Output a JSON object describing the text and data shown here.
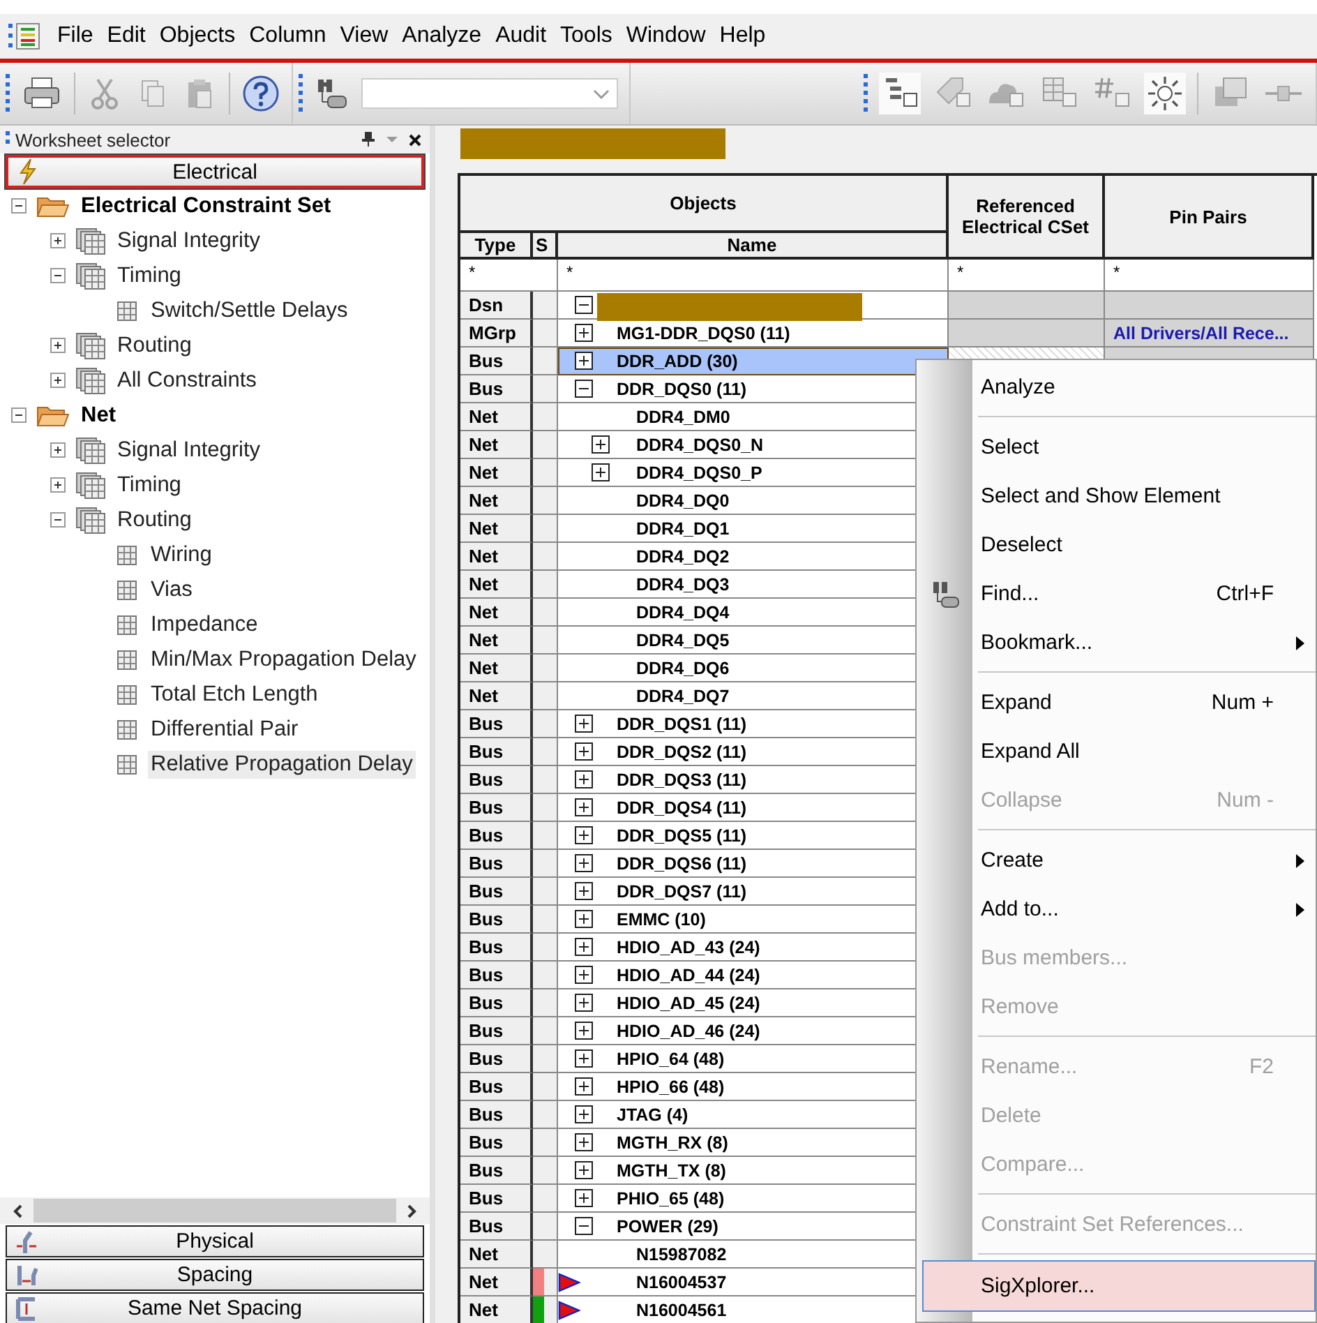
{
  "menu_bar": [
    "File",
    "Edit",
    "Objects",
    "Column",
    "View",
    "Analyze",
    "Audit",
    "Tools",
    "Window",
    "Help"
  ],
  "worksheet_selector": {
    "title": "Worksheet selector",
    "tabs": [
      {
        "label": "Electrical",
        "selected": true,
        "kind": "electrical"
      }
    ],
    "tree": [
      {
        "label": "Electrical Constraint Set",
        "kind": "folder",
        "expanded": true,
        "selected": false,
        "children": [
          {
            "label": "Signal Integrity",
            "kind": "stack",
            "expanded": false,
            "selected": false
          },
          {
            "label": "Timing",
            "kind": "stack",
            "expanded": true,
            "selected": false,
            "children": [
              {
                "label": "Switch/Settle Delays",
                "kind": "sheet",
                "selected": false
              }
            ]
          },
          {
            "label": "Routing",
            "kind": "stack",
            "expanded": false,
            "selected": false
          },
          {
            "label": "All Constraints",
            "kind": "stack",
            "expanded": false,
            "selected": false
          }
        ]
      },
      {
        "label": "Net",
        "kind": "folder",
        "expanded": true,
        "selected": false,
        "children": [
          {
            "label": "Signal Integrity",
            "kind": "stack",
            "expanded": false,
            "selected": false
          },
          {
            "label": "Timing",
            "kind": "stack",
            "expanded": false,
            "selected": false
          },
          {
            "label": "Routing",
            "kind": "stack",
            "expanded": true,
            "selected": false,
            "children": [
              {
                "label": "Wiring",
                "kind": "sheet",
                "selected": false
              },
              {
                "label": "Vias",
                "kind": "sheet",
                "selected": false
              },
              {
                "label": "Impedance",
                "kind": "sheet",
                "selected": false
              },
              {
                "label": "Min/Max Propagation Delay",
                "kind": "sheet",
                "selected": false
              },
              {
                "label": "Total Etch Length",
                "kind": "sheet",
                "selected": false
              },
              {
                "label": "Differential Pair",
                "kind": "sheet",
                "selected": false
              },
              {
                "label": "Relative Propagation Delay",
                "kind": "sheet",
                "selected": true
              }
            ]
          }
        ]
      }
    ],
    "bottom_tabs": [
      {
        "label": "Physical",
        "selected": false,
        "kind": "physical"
      },
      {
        "label": "Spacing",
        "selected": false,
        "kind": "spacing"
      },
      {
        "label": "Same Net Spacing",
        "selected": false,
        "kind": "same-net"
      }
    ]
  },
  "table": {
    "group_header": "Objects",
    "columns": [
      "Type",
      "S",
      "Name",
      "Referenced Electrical CSet",
      "Pin Pairs"
    ],
    "filters": [
      "*",
      "*",
      "*",
      "*"
    ],
    "rows": [
      {
        "type": "Dsn",
        "expanded": true,
        "selected": false,
        "children": [
          {
            "type": "MGrp",
            "name": "MG1-DDR_DQS0 (11)",
            "expanded": false,
            "selected": false,
            "pin_pairs": "All Drivers/All Rece..."
          },
          {
            "type": "Bus",
            "name": "DDR_ADD (30)",
            "expanded": false,
            "selected": true
          },
          {
            "type": "Bus",
            "name": "DDR_DQS0 (11)",
            "expanded": true,
            "selected": false,
            "children": [
              {
                "type": "Net",
                "name": "DDR4_DM0",
                "selected": false
              },
              {
                "type": "Net",
                "name": "DDR4_DQS0_N",
                "expanded": false,
                "selected": false
              },
              {
                "type": "Net",
                "name": "DDR4_DQS0_P",
                "expanded": false,
                "selected": false
              },
              {
                "type": "Net",
                "name": "DDR4_DQ0",
                "selected": false
              },
              {
                "type": "Net",
                "name": "DDR4_DQ1",
                "selected": false
              },
              {
                "type": "Net",
                "name": "DDR4_DQ2",
                "selected": false
              },
              {
                "type": "Net",
                "name": "DDR4_DQ3",
                "selected": false
              },
              {
                "type": "Net",
                "name": "DDR4_DQ4",
                "selected": false
              },
              {
                "type": "Net",
                "name": "DDR4_DQ5",
                "selected": false
              },
              {
                "type": "Net",
                "name": "DDR4_DQ6",
                "selected": false
              },
              {
                "type": "Net",
                "name": "DDR4_DQ7",
                "selected": false
              }
            ]
          },
          {
            "type": "Bus",
            "name": "DDR_DQS1 (11)",
            "expanded": false,
            "selected": false
          },
          {
            "type": "Bus",
            "name": "DDR_DQS2 (11)",
            "expanded": false,
            "selected": false
          },
          {
            "type": "Bus",
            "name": "DDR_DQS3 (11)",
            "expanded": false,
            "selected": false
          },
          {
            "type": "Bus",
            "name": "DDR_DQS4 (11)",
            "expanded": false,
            "selected": false
          },
          {
            "type": "Bus",
            "name": "DDR_DQS5 (11)",
            "expanded": false,
            "selected": false
          },
          {
            "type": "Bus",
            "name": "DDR_DQS6 (11)",
            "expanded": false,
            "selected": false
          },
          {
            "type": "Bus",
            "name": "DDR_DQS7 (11)",
            "expanded": false,
            "selected": false
          },
          {
            "type": "Bus",
            "name": "EMMC (10)",
            "expanded": false,
            "selected": false
          },
          {
            "type": "Bus",
            "name": "HDIO_AD_43 (24)",
            "expanded": false,
            "selected": false
          },
          {
            "type": "Bus",
            "name": "HDIO_AD_44 (24)",
            "expanded": false,
            "selected": false
          },
          {
            "type": "Bus",
            "name": "HDIO_AD_45 (24)",
            "expanded": false,
            "selected": false
          },
          {
            "type": "Bus",
            "name": "HDIO_AD_46 (24)",
            "expanded": false,
            "selected": false
          },
          {
            "type": "Bus",
            "name": "HPIO_64 (48)",
            "expanded": false,
            "selected": false
          },
          {
            "type": "Bus",
            "name": "HPIO_66 (48)",
            "expanded": false,
            "selected": false
          },
          {
            "type": "Bus",
            "name": "JTAG (4)",
            "expanded": false,
            "selected": false
          },
          {
            "type": "Bus",
            "name": "MGTH_RX (8)",
            "expanded": false,
            "selected": false
          },
          {
            "type": "Bus",
            "name": "MGTH_TX (8)",
            "expanded": false,
            "selected": false
          },
          {
            "type": "Bus",
            "name": "PHIO_65 (48)",
            "expanded": false,
            "selected": false
          },
          {
            "type": "Bus",
            "name": "POWER (29)",
            "expanded": true,
            "selected": false,
            "children": [
              {
                "type": "Net",
                "name": "N15987082",
                "selected": false
              },
              {
                "type": "Net",
                "name": "N16004537",
                "selected": false,
                "color": "#f28080",
                "flagged": true
              },
              {
                "type": "Net",
                "name": "N16004561",
                "selected": false,
                "color": "#10a010",
                "flagged": true
              }
            ]
          }
        ]
      }
    ]
  },
  "context_menu": [
    {
      "kind": "item",
      "label": "Analyze",
      "selected": false,
      "disabled": false
    },
    {
      "kind": "separator"
    },
    {
      "kind": "item",
      "label": "Select",
      "selected": false,
      "disabled": false
    },
    {
      "kind": "item",
      "label": "Select and Show Element",
      "selected": false,
      "disabled": false
    },
    {
      "kind": "item",
      "label": "Deselect",
      "selected": false,
      "disabled": false
    },
    {
      "kind": "tool",
      "label": "Find...",
      "shortcut": "Ctrl+F",
      "selected": false,
      "disabled": false
    },
    {
      "kind": "item",
      "label": "Bookmark...",
      "submenu": true,
      "selected": false,
      "disabled": false
    },
    {
      "kind": "separator"
    },
    {
      "kind": "item",
      "label": "Expand",
      "shortcut": "Num +",
      "selected": false,
      "disabled": false
    },
    {
      "kind": "item",
      "label": "Expand All",
      "selected": false,
      "disabled": false
    },
    {
      "kind": "item",
      "label": "Collapse",
      "shortcut": "Num -",
      "selected": false,
      "disabled": true
    },
    {
      "kind": "separator"
    },
    {
      "kind": "item",
      "label": "Create",
      "submenu": true,
      "selected": false,
      "disabled": false
    },
    {
      "kind": "item",
      "label": "Add to...",
      "submenu": true,
      "selected": false,
      "disabled": false
    },
    {
      "kind": "item",
      "label": "Bus members...",
      "selected": false,
      "disabled": true
    },
    {
      "kind": "item",
      "label": "Remove",
      "selected": false,
      "disabled": true
    },
    {
      "kind": "separator"
    },
    {
      "kind": "item",
      "label": "Rename...",
      "shortcut": "F2",
      "selected": false,
      "disabled": true
    },
    {
      "kind": "item",
      "label": "Delete",
      "selected": false,
      "disabled": true
    },
    {
      "kind": "item",
      "label": "Compare...",
      "selected": false,
      "disabled": true
    },
    {
      "kind": "separator"
    },
    {
      "kind": "item",
      "label": "Constraint Set References...",
      "selected": false,
      "disabled": true
    },
    {
      "kind": "separator"
    },
    {
      "kind": "item",
      "label": "SigXplorer...",
      "selected": true,
      "disabled": false
    }
  ]
}
